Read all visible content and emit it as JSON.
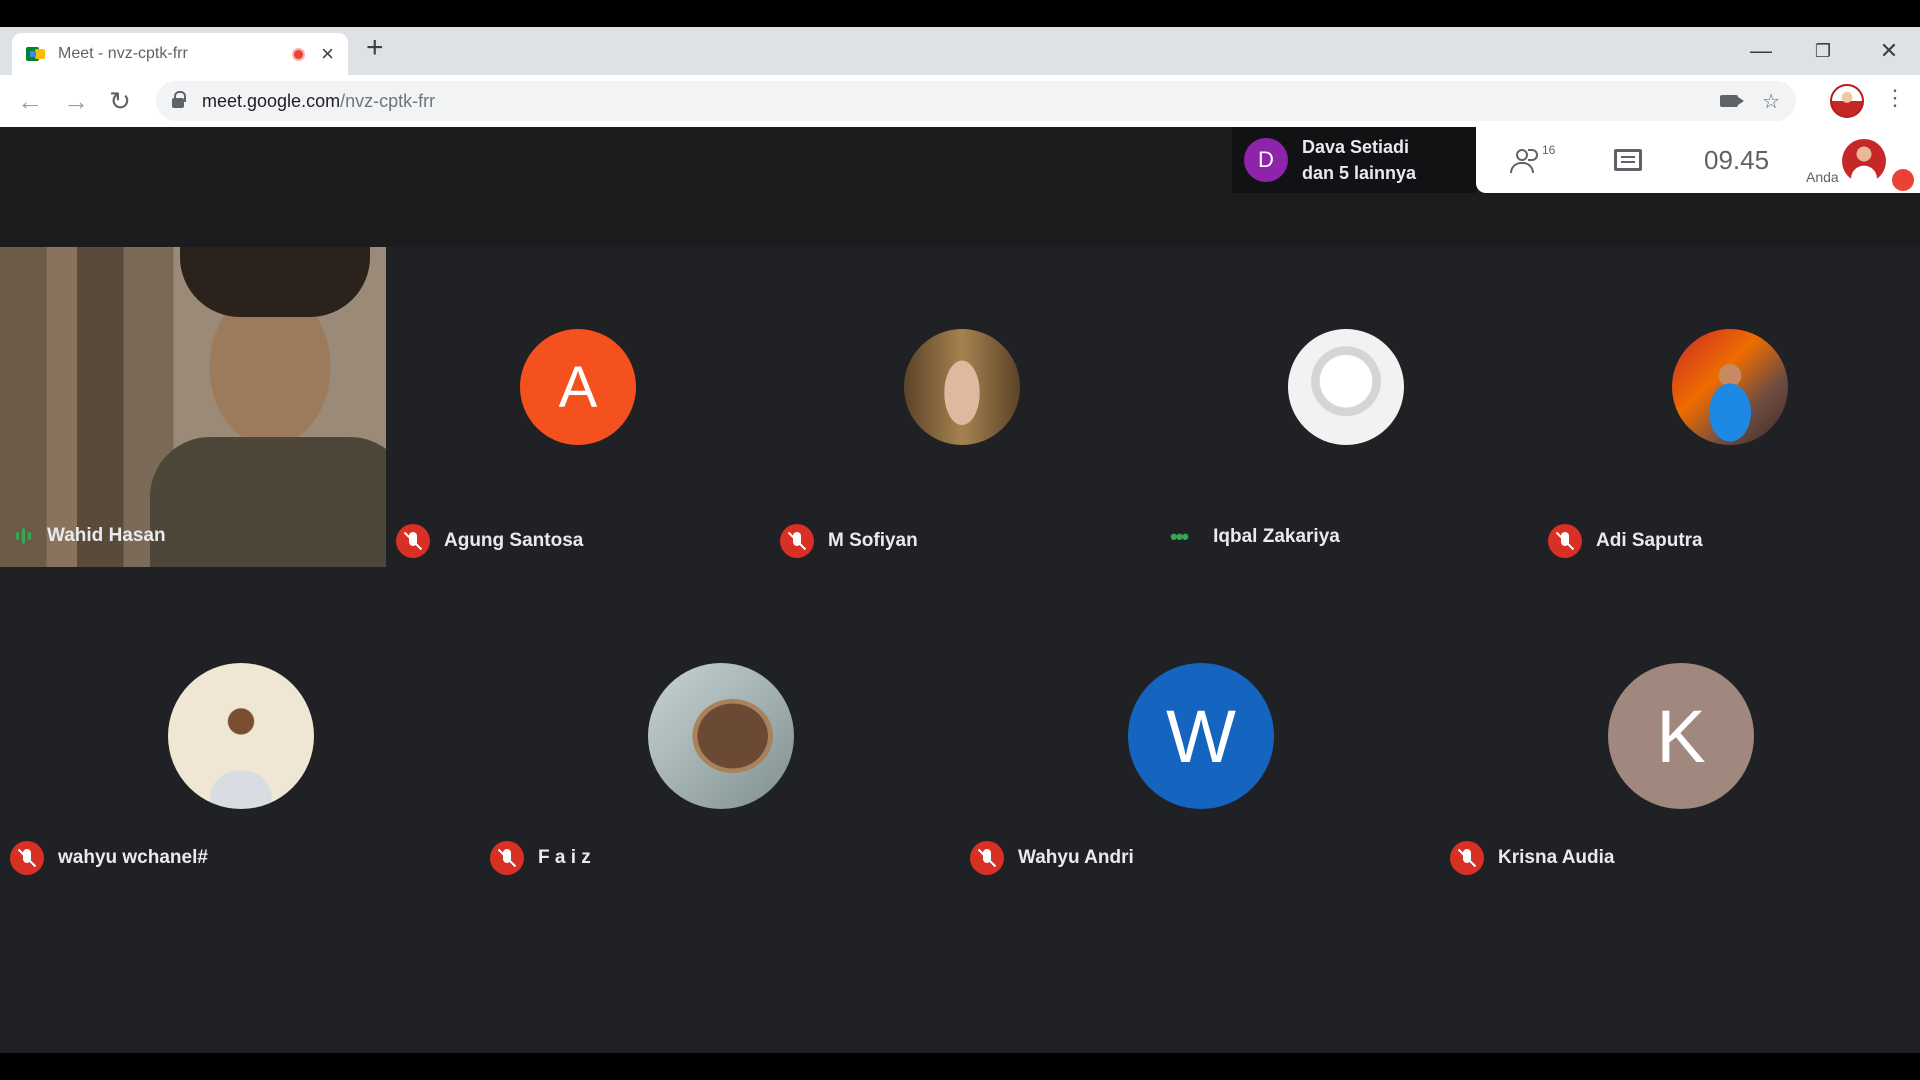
{
  "browser": {
    "tab_title": "Meet - nvz-cptk-frr",
    "tab_close": "×",
    "new_tab": "+",
    "url_host": "meet.google.com",
    "url_path": "/nvz-cptk-frr",
    "window_minimize": "—",
    "window_restore": "❐",
    "window_close": "✕",
    "back": "←",
    "forward": "→",
    "reload": "↻",
    "star": "☆",
    "menu": "⋮"
  },
  "meet": {
    "presenter": {
      "initial": "D",
      "line1": "Dava Setiadi",
      "line2": "dan 5 lainnya",
      "color": "#8e24aa"
    },
    "people_count": "16",
    "time": "09.45",
    "self_label": "Anda",
    "featured": {
      "name": "Wahid Hasan"
    },
    "row1": [
      {
        "name": "Agung Santosa",
        "initial": "A",
        "color": "#f4511e",
        "muted": true
      },
      {
        "name": "M Sofiyan",
        "initial": "",
        "color": "#8d6e4a",
        "muted": true
      },
      {
        "name": "Iqbal Zakariya",
        "initial": "",
        "color": "#e0e0e0",
        "muted": false
      },
      {
        "name": "Adi Saputra",
        "initial": "",
        "color": "#c75b3a",
        "muted": true
      }
    ],
    "row2": [
      {
        "name": "wahyu wchanel#",
        "initial": "",
        "color": "#e8dcc8",
        "muted": true
      },
      {
        "name": "F a i z",
        "initial": "",
        "color": "#9aa7a8",
        "muted": true
      },
      {
        "name": "Wahyu Andri",
        "initial": "W",
        "color": "#1565c0",
        "muted": true
      },
      {
        "name": "Krisna Audia",
        "initial": "K",
        "color": "#a1887f",
        "muted": true
      }
    ]
  }
}
